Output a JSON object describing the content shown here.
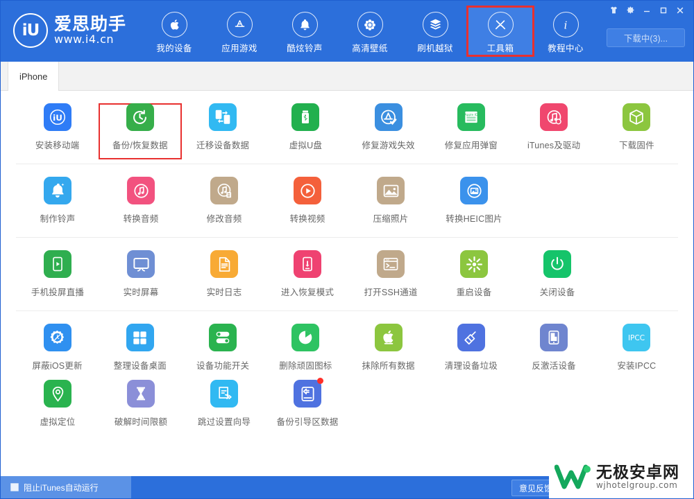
{
  "window": {
    "controls": [
      {
        "name": "skin-icon",
        "label": "皮肤"
      },
      {
        "name": "settings-icon",
        "label": "设置"
      },
      {
        "name": "minimize-icon",
        "label": "最小化"
      },
      {
        "name": "maximize-icon",
        "label": "最大化"
      },
      {
        "name": "close-icon",
        "label": "关闭"
      }
    ]
  },
  "brand": {
    "logo_text": "iU",
    "name": "爱思助手",
    "url": "www.i4.cn"
  },
  "nav": {
    "items": [
      {
        "label": "我的设备",
        "icon": "apple-icon",
        "active": false,
        "highlighted": false
      },
      {
        "label": "应用游戏",
        "icon": "appstore-icon",
        "active": false,
        "highlighted": false
      },
      {
        "label": "酷炫铃声",
        "icon": "bell-icon",
        "active": false,
        "highlighted": false
      },
      {
        "label": "高清壁纸",
        "icon": "flower-icon",
        "active": false,
        "highlighted": false
      },
      {
        "label": "刷机越狱",
        "icon": "box-open-icon",
        "active": false,
        "highlighted": false
      },
      {
        "label": "工具箱",
        "icon": "wrench-icon",
        "active": true,
        "highlighted": true
      },
      {
        "label": "教程中心",
        "icon": "info-icon",
        "active": false,
        "highlighted": false
      }
    ]
  },
  "download_button": {
    "label": "下载中(3)..."
  },
  "tabs": [
    {
      "label": "iPhone",
      "active": true
    }
  ],
  "tool_groups": [
    {
      "items": [
        {
          "label": "安装移动端",
          "icon": "i4-app-icon",
          "color": "#2f7cf6",
          "highlighted": false,
          "badge": false
        },
        {
          "label": "备份/恢复数据",
          "icon": "backup-restore-icon",
          "color": "#36ae4a",
          "highlighted": true,
          "badge": false
        },
        {
          "label": "迁移设备数据",
          "icon": "device-migrate-icon",
          "color": "#31b9f2",
          "highlighted": false,
          "badge": false
        },
        {
          "label": "虚拟U盘",
          "icon": "usb-drive-icon",
          "color": "#22b04e",
          "highlighted": false,
          "badge": false
        },
        {
          "label": "修复游戏失效",
          "icon": "appstore-fix-icon",
          "color": "#3b8fe0",
          "highlighted": false,
          "badge": false
        },
        {
          "label": "修复应用弹窗",
          "icon": "appleid-icon",
          "color": "#27bb5e",
          "highlighted": false,
          "badge": false
        },
        {
          "label": "iTunes及驱动",
          "icon": "itunes-icon",
          "color": "#f0476e",
          "highlighted": false,
          "badge": false
        },
        {
          "label": "下载固件",
          "icon": "firmware-cube-icon",
          "color": "#8cc63f",
          "highlighted": false,
          "badge": false
        }
      ]
    },
    {
      "items": [
        {
          "label": "制作铃声",
          "icon": "ringtone-bell-icon",
          "color": "#34a8ee",
          "highlighted": false,
          "badge": false
        },
        {
          "label": "转换音频",
          "icon": "audio-convert-icon",
          "color": "#f2527f",
          "highlighted": false,
          "badge": false
        },
        {
          "label": "修改音频",
          "icon": "audio-edit-icon",
          "color": "#c0a98b",
          "highlighted": false,
          "badge": false
        },
        {
          "label": "转换视频",
          "icon": "video-convert-icon",
          "color": "#f4603b",
          "highlighted": false,
          "badge": false
        },
        {
          "label": "压缩照片",
          "icon": "photo-compress-icon",
          "color": "#c0a98b",
          "highlighted": false,
          "badge": false
        },
        {
          "label": "转换HEIC图片",
          "icon": "heic-convert-icon",
          "color": "#3b92ec",
          "highlighted": false,
          "badge": false
        }
      ]
    },
    {
      "items": [
        {
          "label": "手机投屏直播",
          "icon": "screen-cast-icon",
          "color": "#2fae4f",
          "highlighted": false,
          "badge": false
        },
        {
          "label": "实时屏幕",
          "icon": "monitor-icon",
          "color": "#6f8fd4",
          "highlighted": false,
          "badge": false
        },
        {
          "label": "实时日志",
          "icon": "log-file-icon",
          "color": "#f8aa35",
          "highlighted": false,
          "badge": false
        },
        {
          "label": "进入恢复模式",
          "icon": "recovery-mode-icon",
          "color": "#ef4271",
          "highlighted": false,
          "badge": false
        },
        {
          "label": "打开SSH通道",
          "icon": "ssh-terminal-icon",
          "color": "#c0a98b",
          "highlighted": false,
          "badge": false
        },
        {
          "label": "重启设备",
          "icon": "restart-icon",
          "color": "#8cc63f",
          "highlighted": false,
          "badge": false
        },
        {
          "label": "关闭设备",
          "icon": "power-off-icon",
          "color": "#15c46a",
          "highlighted": false,
          "badge": false
        }
      ]
    },
    {
      "items": [
        {
          "label": "屏蔽iOS更新",
          "icon": "block-update-icon",
          "color": "#2f90f0",
          "highlighted": false,
          "badge": false
        },
        {
          "label": "整理设备桌面",
          "icon": "arrange-desktop-icon",
          "color": "#31a6f0",
          "highlighted": false,
          "badge": false
        },
        {
          "label": "设备功能开关",
          "icon": "toggle-switch-icon",
          "color": "#2ab34f",
          "highlighted": false,
          "badge": false
        },
        {
          "label": "删除顽固图标",
          "icon": "pie-delete-icon",
          "color": "#2ec362",
          "highlighted": false,
          "badge": false
        },
        {
          "label": "抹除所有数据",
          "icon": "erase-apple-icon",
          "color": "#8cc63f",
          "highlighted": false,
          "badge": false
        },
        {
          "label": "清理设备垃圾",
          "icon": "clean-broom-icon",
          "color": "#4f72e0",
          "highlighted": false,
          "badge": false
        },
        {
          "label": "反激活设备",
          "icon": "deactivate-device-icon",
          "color": "#6f85cf",
          "highlighted": false,
          "badge": false
        },
        {
          "label": "安装IPCC",
          "icon": "ipcc-icon",
          "color": "#3ec6f0",
          "highlighted": false,
          "badge": false
        }
      ]
    },
    {
      "items": [
        {
          "label": "虚拟定位",
          "icon": "location-pin-icon",
          "color": "#2ab34f",
          "highlighted": false,
          "badge": false
        },
        {
          "label": "破解时间限额",
          "icon": "hourglass-icon",
          "color": "#8b8fd8",
          "highlighted": false,
          "badge": false
        },
        {
          "label": "跳过设置向导",
          "icon": "skip-setup-icon",
          "color": "#31b9f2",
          "highlighted": false,
          "badge": false
        },
        {
          "label": "备份引导区数据",
          "icon": "backup-boot-icon",
          "color": "#4f72e0",
          "highlighted": false,
          "badge": true
        }
      ]
    }
  ],
  "footer": {
    "checkbox_label": "阻止iTunes自动运行",
    "feedback_label": "意见反馈"
  },
  "watermark": {
    "cn": "无极安卓网",
    "en": "wjhotelgroup.com"
  }
}
